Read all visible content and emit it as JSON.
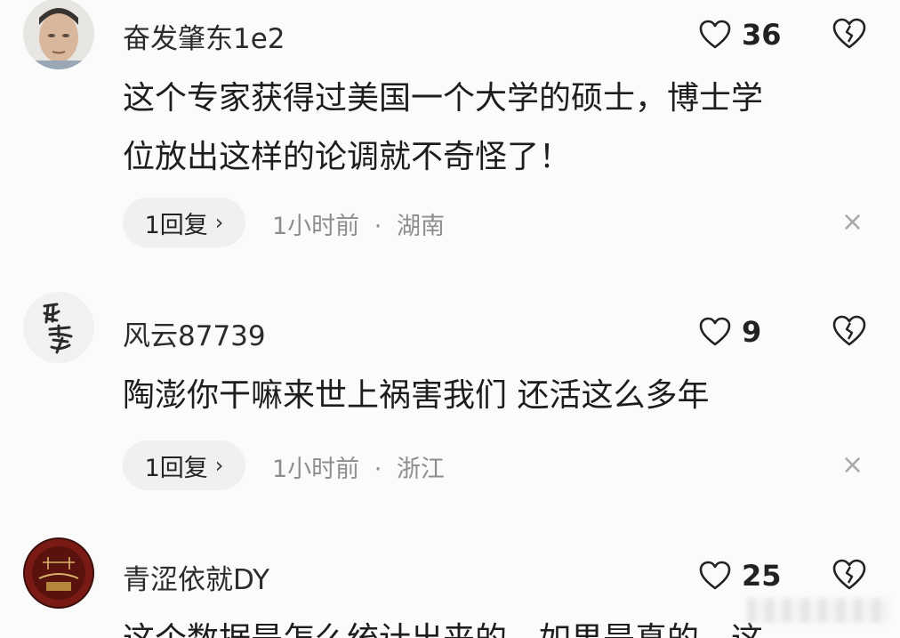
{
  "comments": [
    {
      "username": "奋发肇东1e2",
      "likes": "36",
      "content_lines": [
        "这个专家获得过美国一个大学的硕士，博士学",
        "位放出这样的论调就不奇怪了！"
      ],
      "reply_label": "1回复",
      "time": "1小时前",
      "separator": "·",
      "location": "湖南",
      "avatar_icon": "person-photo-avatar"
    },
    {
      "username": "风云87739",
      "likes": "9",
      "content_lines": [
        "陶澎你干嘛来世上祸害我们 还活这么多年"
      ],
      "reply_label": "1回复",
      "time": "1小时前",
      "separator": "·",
      "location": "浙江",
      "avatar_icon": "calligraphy-avatar"
    },
    {
      "username": "青涩依就DY",
      "likes": "25",
      "content_lines": [
        "这个数据是怎么统计出来的，如果是真的，这"
      ],
      "avatar_icon": "dark-red-circle-avatar"
    }
  ],
  "icons": {
    "like": "heart-outline-icon",
    "dislike": "broken-heart-icon",
    "reply_chevron": "chevron-right-icon",
    "close": "close-icon"
  },
  "glyphs": {
    "chevron": "›",
    "close": "×"
  },
  "colors": {
    "background": "#fbfbfb",
    "meta_text": "#8e8e8e",
    "pill_bg": "#f0f0f0"
  }
}
